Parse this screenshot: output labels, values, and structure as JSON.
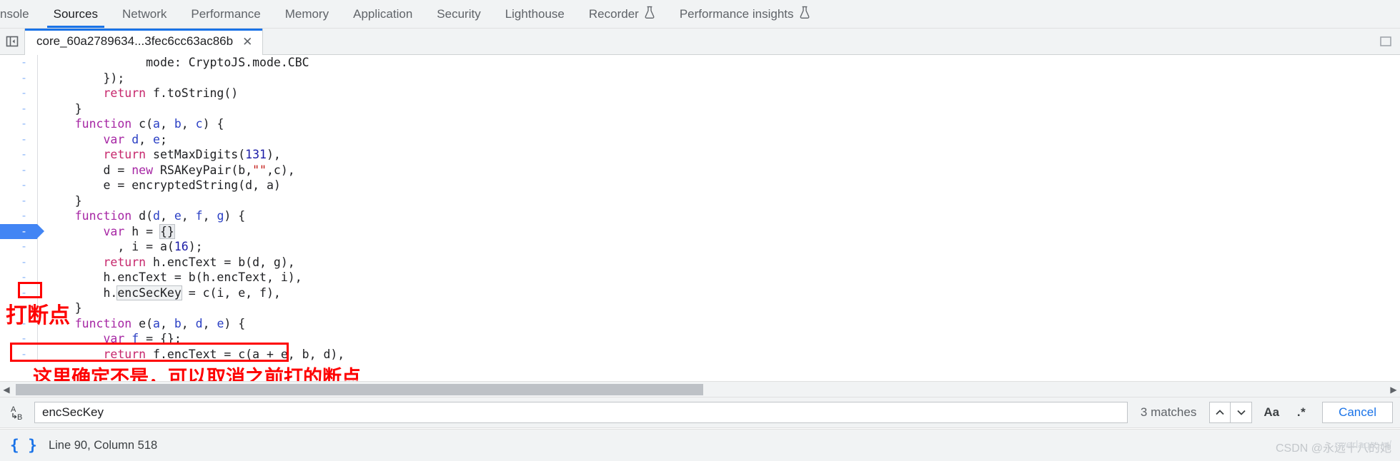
{
  "panel_tabs": [
    {
      "label": "nsole",
      "selected": false,
      "truncated": true,
      "flask": false
    },
    {
      "label": "Sources",
      "selected": true,
      "truncated": false,
      "flask": false
    },
    {
      "label": "Network",
      "selected": false,
      "truncated": false,
      "flask": false
    },
    {
      "label": "Performance",
      "selected": false,
      "truncated": false,
      "flask": false
    },
    {
      "label": "Memory",
      "selected": false,
      "truncated": false,
      "flask": false
    },
    {
      "label": "Application",
      "selected": false,
      "truncated": false,
      "flask": false
    },
    {
      "label": "Security",
      "selected": false,
      "truncated": false,
      "flask": false
    },
    {
      "label": "Lighthouse",
      "selected": false,
      "truncated": false,
      "flask": false
    },
    {
      "label": "Recorder",
      "selected": false,
      "truncated": false,
      "flask": true
    },
    {
      "label": "Performance insights",
      "selected": false,
      "truncated": false,
      "flask": true
    }
  ],
  "file_tab": {
    "name": "core_60a2789634...3fec6cc63ac86b",
    "close_label": "✕",
    "nav_toggle_icon": "show-navigator-icon"
  },
  "editor": {
    "gutter_symbol": "-",
    "lines": [
      {
        "n": 1,
        "indent": 14,
        "segments": [
          {
            "t": "mode: ",
            "c": ""
          },
          {
            "t": "CryptoJS",
            "c": ""
          },
          {
            "t": ".mode.CBC",
            "c": ""
          }
        ]
      },
      {
        "n": 2,
        "indent": 8,
        "segments": [
          {
            "t": "});",
            "c": ""
          }
        ]
      },
      {
        "n": 3,
        "indent": 8,
        "segments": [
          {
            "t": "return",
            "c": "kw2"
          },
          {
            "t": " f.toString()",
            "c": ""
          }
        ]
      },
      {
        "n": 4,
        "indent": 4,
        "segments": [
          {
            "t": "}",
            "c": ""
          }
        ]
      },
      {
        "n": 5,
        "indent": 4,
        "segments": [
          {
            "t": "function",
            "c": "kw"
          },
          {
            "t": " c(",
            "c": ""
          },
          {
            "t": "a",
            "c": "param"
          },
          {
            "t": ", ",
            "c": ""
          },
          {
            "t": "b",
            "c": "param"
          },
          {
            "t": ", ",
            "c": ""
          },
          {
            "t": "c",
            "c": "param"
          },
          {
            "t": ") {",
            "c": ""
          }
        ]
      },
      {
        "n": 6,
        "indent": 8,
        "segments": [
          {
            "t": "var",
            "c": "kw"
          },
          {
            "t": " ",
            "c": ""
          },
          {
            "t": "d",
            "c": "param"
          },
          {
            "t": ", ",
            "c": ""
          },
          {
            "t": "e",
            "c": "param"
          },
          {
            "t": ";",
            "c": ""
          }
        ]
      },
      {
        "n": 7,
        "indent": 8,
        "segments": [
          {
            "t": "return",
            "c": "kw2"
          },
          {
            "t": " setMaxDigits(",
            "c": ""
          },
          {
            "t": "131",
            "c": "num"
          },
          {
            "t": "),",
            "c": ""
          }
        ]
      },
      {
        "n": 8,
        "indent": 8,
        "segments": [
          {
            "t": "d = ",
            "c": ""
          },
          {
            "t": "new",
            "c": "kw"
          },
          {
            "t": " RSAKeyPair(b,",
            "c": ""
          },
          {
            "t": "\"\"",
            "c": "str"
          },
          {
            "t": ",c),",
            "c": ""
          }
        ]
      },
      {
        "n": 9,
        "indent": 8,
        "segments": [
          {
            "t": "e = encryptedString(d, a)",
            "c": ""
          }
        ]
      },
      {
        "n": 10,
        "indent": 4,
        "segments": [
          {
            "t": "}",
            "c": ""
          }
        ]
      },
      {
        "n": 11,
        "indent": 4,
        "segments": [
          {
            "t": "function",
            "c": "kw"
          },
          {
            "t": " d(",
            "c": ""
          },
          {
            "t": "d",
            "c": "param"
          },
          {
            "t": ", ",
            "c": ""
          },
          {
            "t": "e",
            "c": "param"
          },
          {
            "t": ", ",
            "c": ""
          },
          {
            "t": "f",
            "c": "param"
          },
          {
            "t": ", ",
            "c": ""
          },
          {
            "t": "g",
            "c": "param"
          },
          {
            "t": ") {",
            "c": ""
          }
        ]
      },
      {
        "n": 12,
        "indent": 8,
        "breakpoint": true,
        "segments": [
          {
            "t": "var",
            "c": "kw"
          },
          {
            "t": " h = ",
            "c": ""
          },
          {
            "t": "{}",
            "c": "sel-brace"
          },
          {
            "t": "|CARET|",
            "c": "caret"
          }
        ]
      },
      {
        "n": 13,
        "indent": 10,
        "segments": [
          {
            "t": ", i = a(",
            "c": ""
          },
          {
            "t": "16",
            "c": "num"
          },
          {
            "t": ");",
            "c": ""
          }
        ]
      },
      {
        "n": 14,
        "indent": 8,
        "segments": [
          {
            "t": "return",
            "c": "kw2"
          },
          {
            "t": " h.encText = b(d, g),",
            "c": ""
          }
        ]
      },
      {
        "n": 15,
        "indent": 8,
        "segments": [
          {
            "t": "h.encText = b(h.encText, i),",
            "c": ""
          }
        ]
      },
      {
        "n": 16,
        "indent": 8,
        "segments": [
          {
            "t": "h.",
            "c": ""
          },
          {
            "t": "encSecKey",
            "c": "match-hl"
          },
          {
            "t": " = c(i, e, f),",
            "c": ""
          }
        ]
      },
      {
        "n": 17,
        "indent": 4,
        "segments": [
          {
            "t": "}",
            "c": ""
          }
        ]
      },
      {
        "n": 18,
        "indent": 4,
        "segments": [
          {
            "t": "function",
            "c": "kw"
          },
          {
            "t": " e(",
            "c": ""
          },
          {
            "t": "a",
            "c": "param"
          },
          {
            "t": ", ",
            "c": ""
          },
          {
            "t": "b",
            "c": "param"
          },
          {
            "t": ", ",
            "c": ""
          },
          {
            "t": "d",
            "c": "param"
          },
          {
            "t": ", ",
            "c": ""
          },
          {
            "t": "e",
            "c": "param"
          },
          {
            "t": ") {",
            "c": ""
          }
        ]
      },
      {
        "n": 19,
        "indent": 8,
        "segments": [
          {
            "t": "var",
            "c": "kw"
          },
          {
            "t": " ",
            "c": ""
          },
          {
            "t": "f",
            "c": "param"
          },
          {
            "t": " = {};",
            "c": ""
          }
        ]
      },
      {
        "n": 20,
        "indent": 8,
        "segments": [
          {
            "t": "return",
            "c": "kw2"
          },
          {
            "t": " f.encText = c(a + e, b, d),",
            "c": ""
          }
        ]
      }
    ]
  },
  "annotations": {
    "breakpoint_note": "打断点",
    "cancel_note": "这里确定不是，可以取消之前打的断点",
    "color": "#fe0000"
  },
  "search": {
    "value": "encSecKey",
    "placeholder": "",
    "matches_label": "3 matches",
    "prev_label": "⌃",
    "next_label": "⌄",
    "match_case_label": "Aa",
    "regex_label": ".*",
    "cancel_label": "Cancel",
    "icon": "replace-icon"
  },
  "status": {
    "pretty_print_icon": "{ }",
    "position_label": "Line 90, Column 518",
    "watermark": "CSDN @永远十八的她",
    "watermark_overlay": "overlaqe:-n/"
  },
  "colors": {
    "accent": "#1a73e8",
    "breakpoint": "#4285f4",
    "annotation": "#fe0000",
    "chrome_bg": "#f1f3f4"
  }
}
